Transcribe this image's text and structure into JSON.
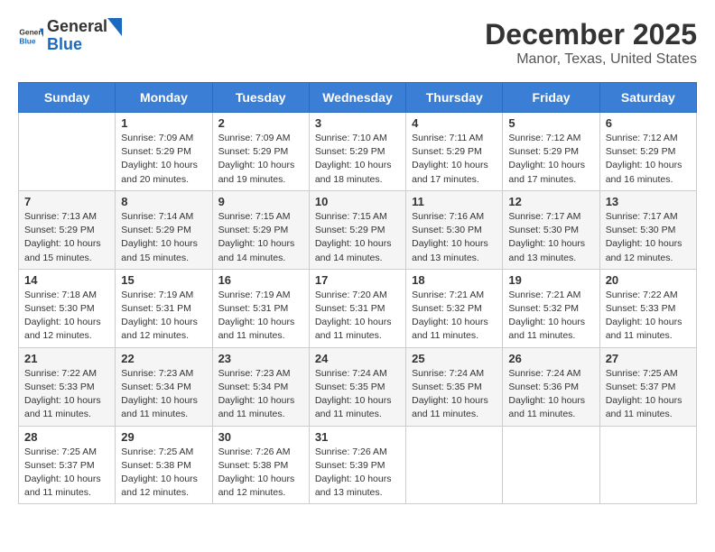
{
  "logo": {
    "general": "General",
    "blue": "Blue"
  },
  "title": "December 2025",
  "subtitle": "Manor, Texas, United States",
  "days_of_week": [
    "Sunday",
    "Monday",
    "Tuesday",
    "Wednesday",
    "Thursday",
    "Friday",
    "Saturday"
  ],
  "weeks": [
    [
      {
        "day": "",
        "info": ""
      },
      {
        "day": "1",
        "info": "Sunrise: 7:09 AM\nSunset: 5:29 PM\nDaylight: 10 hours\nand 20 minutes."
      },
      {
        "day": "2",
        "info": "Sunrise: 7:09 AM\nSunset: 5:29 PM\nDaylight: 10 hours\nand 19 minutes."
      },
      {
        "day": "3",
        "info": "Sunrise: 7:10 AM\nSunset: 5:29 PM\nDaylight: 10 hours\nand 18 minutes."
      },
      {
        "day": "4",
        "info": "Sunrise: 7:11 AM\nSunset: 5:29 PM\nDaylight: 10 hours\nand 17 minutes."
      },
      {
        "day": "5",
        "info": "Sunrise: 7:12 AM\nSunset: 5:29 PM\nDaylight: 10 hours\nand 17 minutes."
      },
      {
        "day": "6",
        "info": "Sunrise: 7:12 AM\nSunset: 5:29 PM\nDaylight: 10 hours\nand 16 minutes."
      }
    ],
    [
      {
        "day": "7",
        "info": "Sunrise: 7:13 AM\nSunset: 5:29 PM\nDaylight: 10 hours\nand 15 minutes."
      },
      {
        "day": "8",
        "info": "Sunrise: 7:14 AM\nSunset: 5:29 PM\nDaylight: 10 hours\nand 15 minutes."
      },
      {
        "day": "9",
        "info": "Sunrise: 7:15 AM\nSunset: 5:29 PM\nDaylight: 10 hours\nand 14 minutes."
      },
      {
        "day": "10",
        "info": "Sunrise: 7:15 AM\nSunset: 5:29 PM\nDaylight: 10 hours\nand 14 minutes."
      },
      {
        "day": "11",
        "info": "Sunrise: 7:16 AM\nSunset: 5:30 PM\nDaylight: 10 hours\nand 13 minutes."
      },
      {
        "day": "12",
        "info": "Sunrise: 7:17 AM\nSunset: 5:30 PM\nDaylight: 10 hours\nand 13 minutes."
      },
      {
        "day": "13",
        "info": "Sunrise: 7:17 AM\nSunset: 5:30 PM\nDaylight: 10 hours\nand 12 minutes."
      }
    ],
    [
      {
        "day": "14",
        "info": "Sunrise: 7:18 AM\nSunset: 5:30 PM\nDaylight: 10 hours\nand 12 minutes."
      },
      {
        "day": "15",
        "info": "Sunrise: 7:19 AM\nSunset: 5:31 PM\nDaylight: 10 hours\nand 12 minutes."
      },
      {
        "day": "16",
        "info": "Sunrise: 7:19 AM\nSunset: 5:31 PM\nDaylight: 10 hours\nand 11 minutes."
      },
      {
        "day": "17",
        "info": "Sunrise: 7:20 AM\nSunset: 5:31 PM\nDaylight: 10 hours\nand 11 minutes."
      },
      {
        "day": "18",
        "info": "Sunrise: 7:21 AM\nSunset: 5:32 PM\nDaylight: 10 hours\nand 11 minutes."
      },
      {
        "day": "19",
        "info": "Sunrise: 7:21 AM\nSunset: 5:32 PM\nDaylight: 10 hours\nand 11 minutes."
      },
      {
        "day": "20",
        "info": "Sunrise: 7:22 AM\nSunset: 5:33 PM\nDaylight: 10 hours\nand 11 minutes."
      }
    ],
    [
      {
        "day": "21",
        "info": "Sunrise: 7:22 AM\nSunset: 5:33 PM\nDaylight: 10 hours\nand 11 minutes."
      },
      {
        "day": "22",
        "info": "Sunrise: 7:23 AM\nSunset: 5:34 PM\nDaylight: 10 hours\nand 11 minutes."
      },
      {
        "day": "23",
        "info": "Sunrise: 7:23 AM\nSunset: 5:34 PM\nDaylight: 10 hours\nand 11 minutes."
      },
      {
        "day": "24",
        "info": "Sunrise: 7:24 AM\nSunset: 5:35 PM\nDaylight: 10 hours\nand 11 minutes."
      },
      {
        "day": "25",
        "info": "Sunrise: 7:24 AM\nSunset: 5:35 PM\nDaylight: 10 hours\nand 11 minutes."
      },
      {
        "day": "26",
        "info": "Sunrise: 7:24 AM\nSunset: 5:36 PM\nDaylight: 10 hours\nand 11 minutes."
      },
      {
        "day": "27",
        "info": "Sunrise: 7:25 AM\nSunset: 5:37 PM\nDaylight: 10 hours\nand 11 minutes."
      }
    ],
    [
      {
        "day": "28",
        "info": "Sunrise: 7:25 AM\nSunset: 5:37 PM\nDaylight: 10 hours\nand 11 minutes."
      },
      {
        "day": "29",
        "info": "Sunrise: 7:25 AM\nSunset: 5:38 PM\nDaylight: 10 hours\nand 12 minutes."
      },
      {
        "day": "30",
        "info": "Sunrise: 7:26 AM\nSunset: 5:38 PM\nDaylight: 10 hours\nand 12 minutes."
      },
      {
        "day": "31",
        "info": "Sunrise: 7:26 AM\nSunset: 5:39 PM\nDaylight: 10 hours\nand 13 minutes."
      },
      {
        "day": "",
        "info": ""
      },
      {
        "day": "",
        "info": ""
      },
      {
        "day": "",
        "info": ""
      }
    ]
  ]
}
